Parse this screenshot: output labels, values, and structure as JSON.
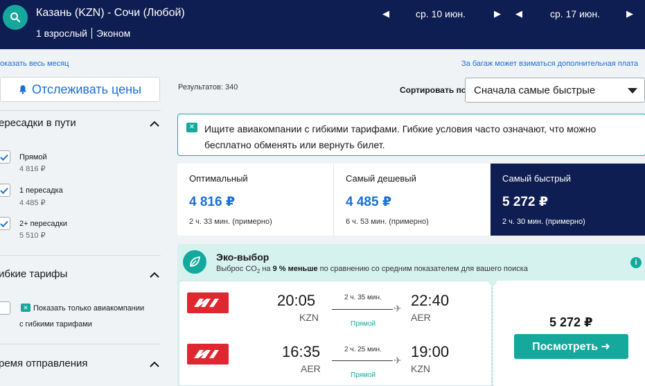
{
  "header": {
    "route": "Казань (KZN) - Сочи (Любой)",
    "passengers": "1 взрослый",
    "cabin": "Эконом",
    "depart_date": "ср. 10 июн.",
    "return_date": "ср. 17 июн."
  },
  "links": {
    "month": "оказать весь месяц",
    "baggage": "За багаж может взиматься дополнительная плата"
  },
  "sidebar": {
    "track_prices": "Отслеживать цены",
    "stops": {
      "title": "ересадки в пути",
      "options": [
        {
          "label": "Прямой",
          "price": "4 816 ₽",
          "checked": true
        },
        {
          "label": "1 пересадка",
          "price": "4 485 ₽",
          "checked": true
        },
        {
          "label": "2+ пересадки",
          "price": "5 510 ₽",
          "checked": true
        }
      ]
    },
    "flex": {
      "title": "ибкие тарифы",
      "option_line1": "Показать только авиакомпании",
      "option_line2": "с гибкими тарифами"
    },
    "departure": {
      "title": "ремя отправления"
    }
  },
  "main": {
    "results": "Результатов: 340",
    "sort_label": "Сортировать по",
    "sort_value": "Сначала самые быстрые",
    "flex_banner": "Ищите авиакомпании с гибкими тарифами. Гибкие условия часто означают, что можно бесплатно обменять или вернуть билет.",
    "tabs": [
      {
        "label": "Оптимальный",
        "price": "4 816 ₽",
        "duration": "2 ч. 33 мин. (примерно)"
      },
      {
        "label": "Самый дешевый",
        "price": "4 485 ₽",
        "duration": "6 ч. 53 мин. (примерно)"
      },
      {
        "label": "Самый быстрый",
        "price": "5 272 ₽",
        "duration": "2 ч. 30 мин. (примерно)"
      }
    ],
    "eco": {
      "title": "Эко-выбор",
      "sub_pre": "Выброс CO",
      "sub_sub": "2",
      "sub_mid": " на ",
      "sub_bold": "9 % меньше",
      "sub_post": " по сравнению со средним показателем для вашего поиска"
    },
    "flights": [
      {
        "dep_time": "20:05",
        "dep_code": "KZN",
        "arr_time": "22:40",
        "arr_code": "AER",
        "duration": "2 ч. 35 мин.",
        "stops": "Прямой"
      },
      {
        "dep_time": "16:35",
        "dep_code": "AER",
        "arr_time": "19:00",
        "arr_code": "KZN",
        "duration": "2 ч. 25 мин.",
        "stops": "Прямой"
      }
    ],
    "price": "5 272 ₽",
    "view_label": "Посмотреть ➜"
  },
  "colors": {
    "header": "#0f1e52",
    "accent": "#15a99d",
    "link": "#1a6ed8",
    "airline": "#e0262f"
  }
}
